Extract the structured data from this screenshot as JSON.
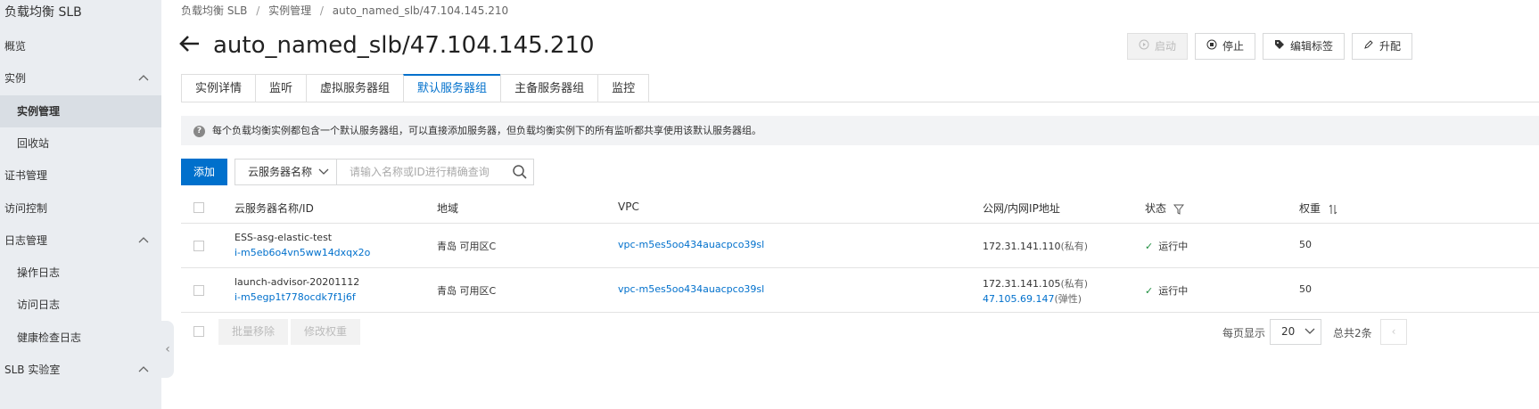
{
  "sidebar": {
    "title": "负载均衡 SLB",
    "items": [
      {
        "label": "概览"
      },
      {
        "label": "实例",
        "chevron": "∧"
      },
      {
        "label": "实例管理"
      },
      {
        "label": "回收站"
      },
      {
        "label": "证书管理"
      },
      {
        "label": "访问控制"
      },
      {
        "label": "日志管理",
        "chevron": "∧"
      },
      {
        "label": "操作日志"
      },
      {
        "label": "访问日志"
      },
      {
        "label": "健康检查日志"
      },
      {
        "label": "SLB 实验室",
        "chevron": "∧"
      }
    ]
  },
  "breadcrumb": [
    "负载均衡 SLB",
    "实例管理",
    "auto_named_slb/47.104.145.210"
  ],
  "breadcrumb_sep": "/",
  "page_title": "auto_named_slb/47.104.145.210",
  "actions": {
    "start": "启动",
    "stop": "停止",
    "edit_tags": "编辑标签",
    "upgrade": "升配"
  },
  "tabs": [
    "实例详情",
    "监听",
    "虚拟服务器组",
    "默认服务器组",
    "主备服务器组",
    "监控"
  ],
  "notice": "每个负载均衡实例都包含一个默认服务器组，可以直接添加服务器，但负载均衡实例下的所有监听都共享使用该默认服务器组。",
  "toolbar": {
    "add_label": "添加",
    "filter_select": "云服务器名称",
    "search_placeholder": "请输入名称或ID进行精确查询"
  },
  "table": {
    "headers": {
      "name": "云服务器名称/ID",
      "region": "地域",
      "vpc": "VPC",
      "ip": "公网/内网IP地址",
      "status": "状态",
      "weight": "权重"
    },
    "rows": [
      {
        "name": "ESS-asg-elastic-test",
        "id": "i-m5eb6o4vn5ww14dxqx2o",
        "region": "青岛 可用区C",
        "vpc": "vpc-m5es5oo434auacpco39sl",
        "ip1": "172.31.141.110",
        "ip1_type": "(私有)",
        "ip2": "",
        "ip2_type": "",
        "status": "运行中",
        "weight": "50"
      },
      {
        "name": "launch-advisor-20201112",
        "id": "i-m5egp1t778ocdk7f1j6f",
        "region": "青岛 可用区C",
        "vpc": "vpc-m5es5oo434auacpco39sl",
        "ip1": "172.31.141.105",
        "ip1_type": "(私有)",
        "ip2": "47.105.69.147",
        "ip2_type": "(弹性)",
        "status": "运行中",
        "weight": "50"
      }
    ]
  },
  "footer": {
    "batch_remove": "批量移除",
    "modify_weight": "修改权重",
    "page_size_label": "每页显示",
    "page_size": "20",
    "total": "总共2条"
  },
  "colors": {
    "accent": "#0070cc",
    "sidebar_bg": "#eaedf1",
    "success": "#1e8e3e"
  }
}
